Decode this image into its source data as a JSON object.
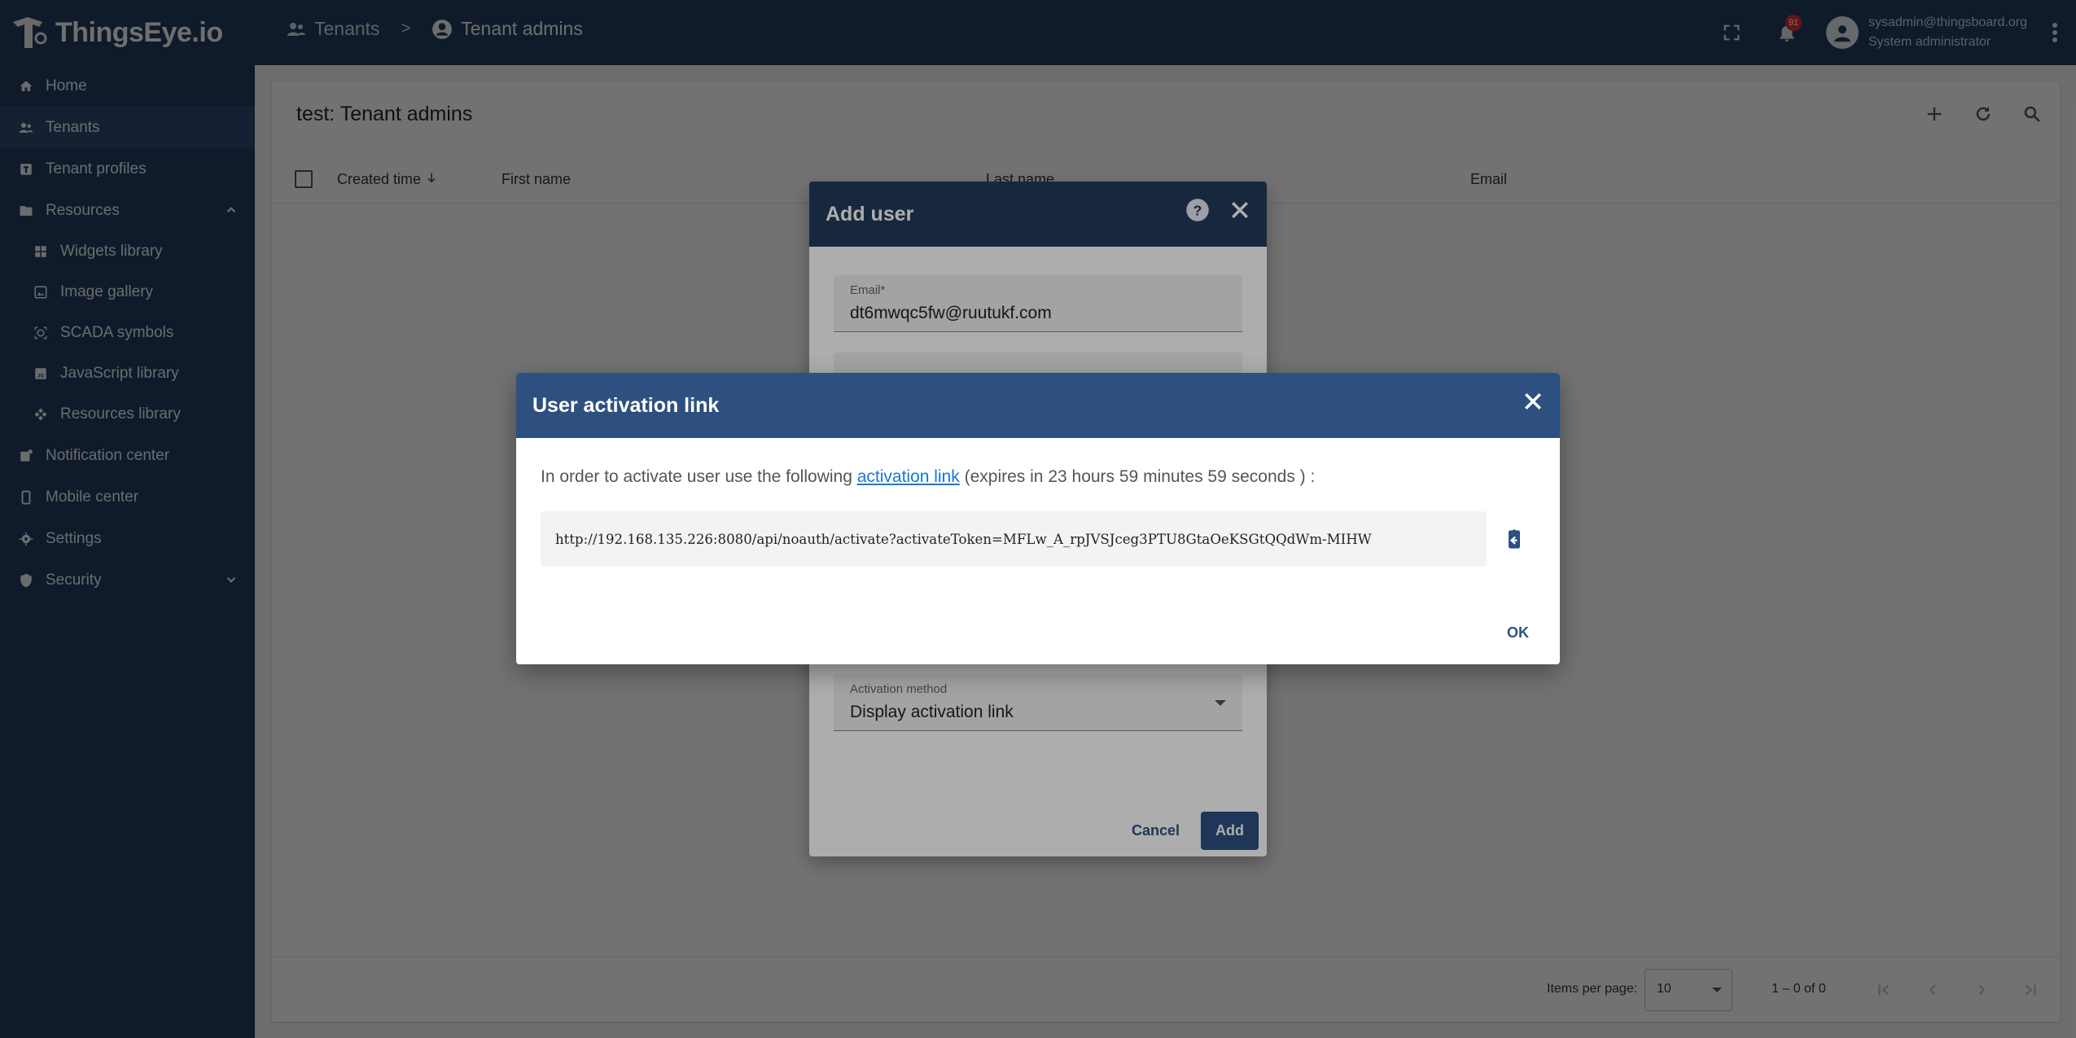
{
  "app": {
    "logo_text": "ThingsEye.io"
  },
  "breadcrumb": {
    "item1": "Tenants",
    "separator": ">",
    "item2": "Tenant admins"
  },
  "topbar": {
    "notification_count": "91",
    "user_email": "sysadmin@thingsboard.org",
    "user_role": "System administrator"
  },
  "sidebar": {
    "items": [
      {
        "label": "Home",
        "icon": "home-icon"
      },
      {
        "label": "Tenants",
        "icon": "tenants-icon"
      },
      {
        "label": "Tenant profiles",
        "icon": "tenant-profiles-icon"
      },
      {
        "label": "Resources",
        "icon": "folder-icon"
      },
      {
        "label": "Widgets library",
        "icon": "widgets-icon"
      },
      {
        "label": "Image gallery",
        "icon": "image-icon"
      },
      {
        "label": "SCADA symbols",
        "icon": "scada-icon"
      },
      {
        "label": "JavaScript library",
        "icon": "javascript-icon"
      },
      {
        "label": "Resources library",
        "icon": "resources-library-icon"
      },
      {
        "label": "Notification center",
        "icon": "notification-center-icon"
      },
      {
        "label": "Mobile center",
        "icon": "mobile-icon"
      },
      {
        "label": "Settings",
        "icon": "gear-icon"
      },
      {
        "label": "Security",
        "icon": "shield-icon"
      }
    ]
  },
  "main": {
    "title": "test: Tenant admins",
    "columns": [
      "Created time",
      "First name",
      "Last name",
      "Email"
    ]
  },
  "paginator": {
    "items_per_page_label": "Items per page:",
    "items_per_page": "10",
    "range": "1 – 0 of 0"
  },
  "add_user_dialog": {
    "title": "Add user",
    "email_label": "Email*",
    "email_value": "dt6mwqc5fw@ruutukf.com",
    "activation_label": "Activation method",
    "activation_value": "Display activation link",
    "cancel_label": "Cancel",
    "add_label": "Add"
  },
  "activation_dialog": {
    "title": "User activation link",
    "text_before": "In order to activate user use the following ",
    "link_text": "activation link",
    "text_after": " (expires in 23 hours 59 minutes 59 seconds ) :",
    "url": "http://192.168.135.226:8080/api/noauth/activate?activateToken=MFLw_A_rpJVSJceg3PTU8GtaOeKSGtQQdWm-MIHW",
    "ok_label": "OK"
  },
  "colors": {
    "primary": "#223b5c",
    "dialog_header": "#2d5080",
    "link": "#1976d2",
    "badge": "#d32f2f"
  }
}
